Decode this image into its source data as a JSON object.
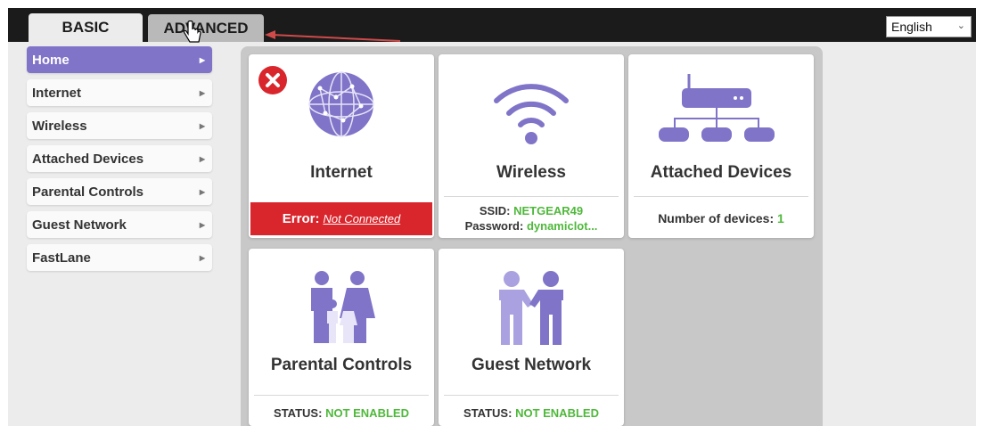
{
  "tabs": {
    "basic": "BASIC",
    "advanced": "ADVANCED"
  },
  "language": {
    "selected": "English"
  },
  "sidebar": {
    "items": [
      {
        "label": "Home"
      },
      {
        "label": "Internet"
      },
      {
        "label": "Wireless"
      },
      {
        "label": "Attached Devices"
      },
      {
        "label": "Parental Controls"
      },
      {
        "label": "Guest Network"
      },
      {
        "label": "FastLane"
      }
    ]
  },
  "cards": {
    "internet": {
      "title": "Internet",
      "error_label": "Error:",
      "error_link": "Not Connected"
    },
    "wireless": {
      "title": "Wireless",
      "ssid_label": "SSID:",
      "ssid_value": "NETGEAR49",
      "password_label": "Password:",
      "password_value": "dynamiclot..."
    },
    "attached": {
      "title": "Attached Devices",
      "count_label": "Number of devices:",
      "count_value": "1"
    },
    "parental": {
      "title": "Parental Controls",
      "status_label": "STATUS:",
      "status_value": "NOT ENABLED"
    },
    "guest": {
      "title": "Guest Network",
      "status_label": "STATUS:",
      "status_value": "NOT ENABLED"
    }
  },
  "colors": {
    "accent": "#7f74c8",
    "error": "#d9252c",
    "ok": "#4fb83b"
  },
  "icons": [
    "globe-icon",
    "error-x-icon",
    "wifi-icon",
    "router-icon",
    "family-icon",
    "handshake-icon",
    "dropdown-chevron-icon",
    "hand-cursor-icon",
    "annotation-arrow"
  ]
}
